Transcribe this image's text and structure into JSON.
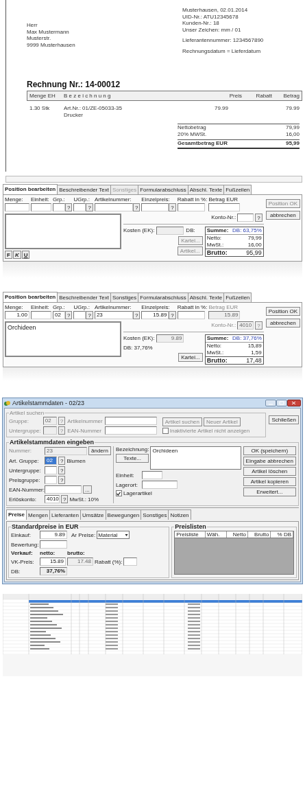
{
  "invoice": {
    "address_lines": [
      "Herr",
      "Max Mustermann",
      "Musterstr.",
      "9999 Musterhausen"
    ],
    "info_groups": [
      [
        "Musterhausen, 02.01.2014",
        "UID-Nr.: ATU12345678",
        "Kunden-Nr.: 18",
        "Unser Zeichen: mm / 01"
      ],
      [
        "Lieferantennummer: 1234567890"
      ],
      [
        "Rechnungsdatum = Lieferdatum"
      ]
    ],
    "title": "Rechnung Nr.: 14-00012",
    "columns": [
      "Menge EH",
      "B e z e i c h n u n g",
      "Preis",
      "Rabatt",
      "Betrag"
    ],
    "item": {
      "quantity": "1.30 Stk",
      "description_lines": [
        "Art.Nr.: 01/ZE-05033-35",
        "Drucker"
      ],
      "price": "79.99",
      "amount": "79.99"
    },
    "totals": [
      {
        "label": "Nettobetrag",
        "value": "79,99",
        "kind": "row"
      },
      {
        "label": "20% MWSt.",
        "value": "16,00",
        "kind": "row"
      },
      {
        "label": "Gesamtbetrag EUR",
        "value": "95,99",
        "kind": "total"
      }
    ]
  },
  "editors": [
    {
      "tabs": [
        {
          "label": "Position bearbeiten",
          "selected": true,
          "disabled": false
        },
        {
          "label": "Beschreibender Text",
          "selected": false,
          "disabled": false
        },
        {
          "label": "Sonstiges",
          "selected": false,
          "disabled": true
        },
        {
          "label": "Formularabschluss",
          "selected": false,
          "disabled": false
        },
        {
          "label": "Abschl. Texte",
          "selected": false,
          "disabled": false
        },
        {
          "label": "Fußzeilen",
          "selected": false,
          "disabled": false
        }
      ],
      "fields": [
        {
          "label": "Menge:",
          "disabled": false
        },
        {
          "label": "Einheit:",
          "disabled": false
        },
        {
          "label": "Grp.:",
          "lookup": "?",
          "disabled": false
        },
        {
          "label": "UGrp.:",
          "lookup": "?",
          "disabled": false
        },
        {
          "label": "Artikelnummer:",
          "lookup": "?",
          "disabled": false
        },
        {
          "label": "Einzelpreis:",
          "lookup": "?",
          "disabled": false
        },
        {
          "label": "Rabatt in %:",
          "disabled": false
        },
        {
          "label": "Betrag EUR",
          "disabled": false
        }
      ],
      "buttons": [
        {
          "label": "Position OK",
          "disabled": true
        },
        {
          "label": "abbrechen",
          "disabled": false
        }
      ],
      "account": {
        "label": "Konto-Nr.:",
        "lookup": "?",
        "disabled": false
      },
      "format_buttons": [
        "F",
        "K",
        "U"
      ],
      "cost": {
        "label": "Kosten (EK):",
        "db": "DB:",
        "buttons": [
          {
            "label": "Kartei...",
            "disabled": true
          },
          {
            "label": "Artikel...",
            "disabled": true
          }
        ]
      },
      "summary": [
        {
          "label": "Summe:",
          "value": "DB: 63,75%",
          "kind": "head"
        },
        {
          "label": "Netto:",
          "value": "79,99",
          "kind": "row"
        },
        {
          "label": "MwSt.:",
          "value": "16,00",
          "kind": "row"
        },
        {
          "label": "Brutto:",
          "value": "95,99",
          "kind": "total"
        }
      ]
    },
    {
      "tabs": [
        {
          "label": "Position bearbeiten",
          "selected": true,
          "disabled": false
        },
        {
          "label": "Beschreibender Text",
          "selected": false,
          "disabled": false
        },
        {
          "label": "Sonstiges",
          "selected": false,
          "disabled": false
        },
        {
          "label": "Formularabschluss",
          "selected": false,
          "disabled": false
        },
        {
          "label": "Abschl. Texte",
          "selected": false,
          "disabled": false
        },
        {
          "label": "Fußzeilen",
          "selected": false,
          "disabled": false
        }
      ],
      "fields": [
        {
          "label": "Menge:",
          "value": "1.00",
          "disabled": false
        },
        {
          "label": "Einheit:",
          "disabled": false
        },
        {
          "label": "Grp.:",
          "value": "02",
          "lookup": "?",
          "disabled": false
        },
        {
          "label": "UGrp.:",
          "lookup": "?",
          "disabled": false
        },
        {
          "label": "Artikelnummer:",
          "value": "23",
          "lookup": "?",
          "disabled": false
        },
        {
          "label": "Einzelpreis:",
          "value": "15.89",
          "lookup": "?",
          "disabled": false
        },
        {
          "label": "Rabatt in %:",
          "disabled": false
        },
        {
          "label": "Betrag EUR",
          "value": "15.89",
          "disabled": true
        }
      ],
      "buttons": [
        {
          "label": "Position OK",
          "disabled": false
        },
        {
          "label": "abbrechen",
          "disabled": false
        }
      ],
      "account": {
        "label": "Konto-Nr.:",
        "value": "4010",
        "lookup": "?",
        "disabled": true
      },
      "text": "Orchideen",
      "cost": {
        "label": "Kosten (EK):",
        "value": "9.89",
        "db": "DB: 37,76%",
        "buttons": [
          {
            "label": "Kartei...",
            "disabled": false
          }
        ]
      },
      "summary": [
        {
          "label": "Summe:",
          "value": "DB: 37,76%",
          "kind": "head"
        },
        {
          "label": "Netto:",
          "value": "15,89",
          "kind": "row"
        },
        {
          "label": "MwSt.:",
          "value": "1,59",
          "kind": "row"
        },
        {
          "label": "Brutto:",
          "value": "17,48",
          "kind": "total"
        }
      ]
    }
  ],
  "dialog": {
    "title": "Artikelstammdaten - 02/23",
    "search": {
      "legend": "Artikel suchen",
      "fields": [
        {
          "label": "Gruppe:",
          "value": "02",
          "lookup": "?"
        },
        {
          "label": "Artikelnummer"
        },
        {
          "label": "Untergruppe:",
          "lookup": "?"
        },
        {
          "label": "EAN-Nummer"
        }
      ],
      "buttons": [
        "Artikel suchen",
        "Neuer Artikel"
      ],
      "checkbox": {
        "label": "Inaktivierte Artikel nicht anzeigen",
        "checked": false
      }
    },
    "close_button": "Schließen",
    "entry": {
      "legend": "Artikelstammdaten eingeben",
      "left": [
        {
          "label": "Nummer:",
          "value": "23",
          "disabled": true,
          "action": "ändern"
        },
        {
          "label": "Art. Gruppe:",
          "value": "02",
          "disabled": false,
          "selected": true,
          "lookup": "?",
          "note": "Blumen"
        },
        {
          "label": "Untergruppe:",
          "disabled": false,
          "selected": false,
          "lookup": "?"
        },
        {
          "label": "Preisgruppe:",
          "disabled": false,
          "selected": false,
          "lookup": "?"
        },
        {
          "label": "EAN-Nummer:",
          "disabled": false,
          "selected": false,
          "lookup": "..."
        },
        {
          "label": "Erlöskonto:",
          "value": "4010",
          "disabled": false,
          "selected": false,
          "lookup": "?",
          "note": "MwSt.: 10%"
        }
      ],
      "description": {
        "label": "Bezeichnung:",
        "value": "Orchideen",
        "button": "Texte..."
      },
      "middle": [
        {
          "label": "Einheit:"
        },
        {
          "label": "Lagerort:"
        }
      ],
      "checkbox": {
        "label": "Lagerartikel",
        "checked": true
      },
      "buttons": [
        "OK (speichern)",
        "Eingabe abbrechen",
        "Artikel löschen",
        "Artikel kopieren",
        "Erweitert..."
      ]
    },
    "tabs": [
      {
        "label": "Preise",
        "selected": true
      },
      {
        "label": "Mengen",
        "selected": false
      },
      {
        "label": "Lieferanten",
        "selected": false
      },
      {
        "label": "Umsätze",
        "selected": false
      },
      {
        "label": "Bewegungen",
        "selected": false
      },
      {
        "label": "Sonstiges",
        "selected": false
      },
      {
        "label": "Notizen",
        "selected": false
      }
    ],
    "prices": {
      "legend": "Standardpreise in EUR",
      "purchase": {
        "label": "Einkauf:",
        "value": "9.89"
      },
      "price_type": {
        "label": "Ar Preise:",
        "value": "Material"
      },
      "valuation": {
        "label": "Bewertung:"
      },
      "sale_headers": [
        "Verkauf:",
        "netto:",
        "brutto:"
      ],
      "sale": {
        "label": "VK-Preis:",
        "net": "15.89",
        "gross": "17.48",
        "discount_label": "Rabatt (%):"
      },
      "db": {
        "label": "DB:",
        "value": "37,76%"
      }
    },
    "price_lists": {
      "legend": "Preislisten",
      "columns": [
        "Preisliste",
        "Wäh.",
        "Netto",
        "Brutto",
        "% DB"
      ]
    }
  }
}
